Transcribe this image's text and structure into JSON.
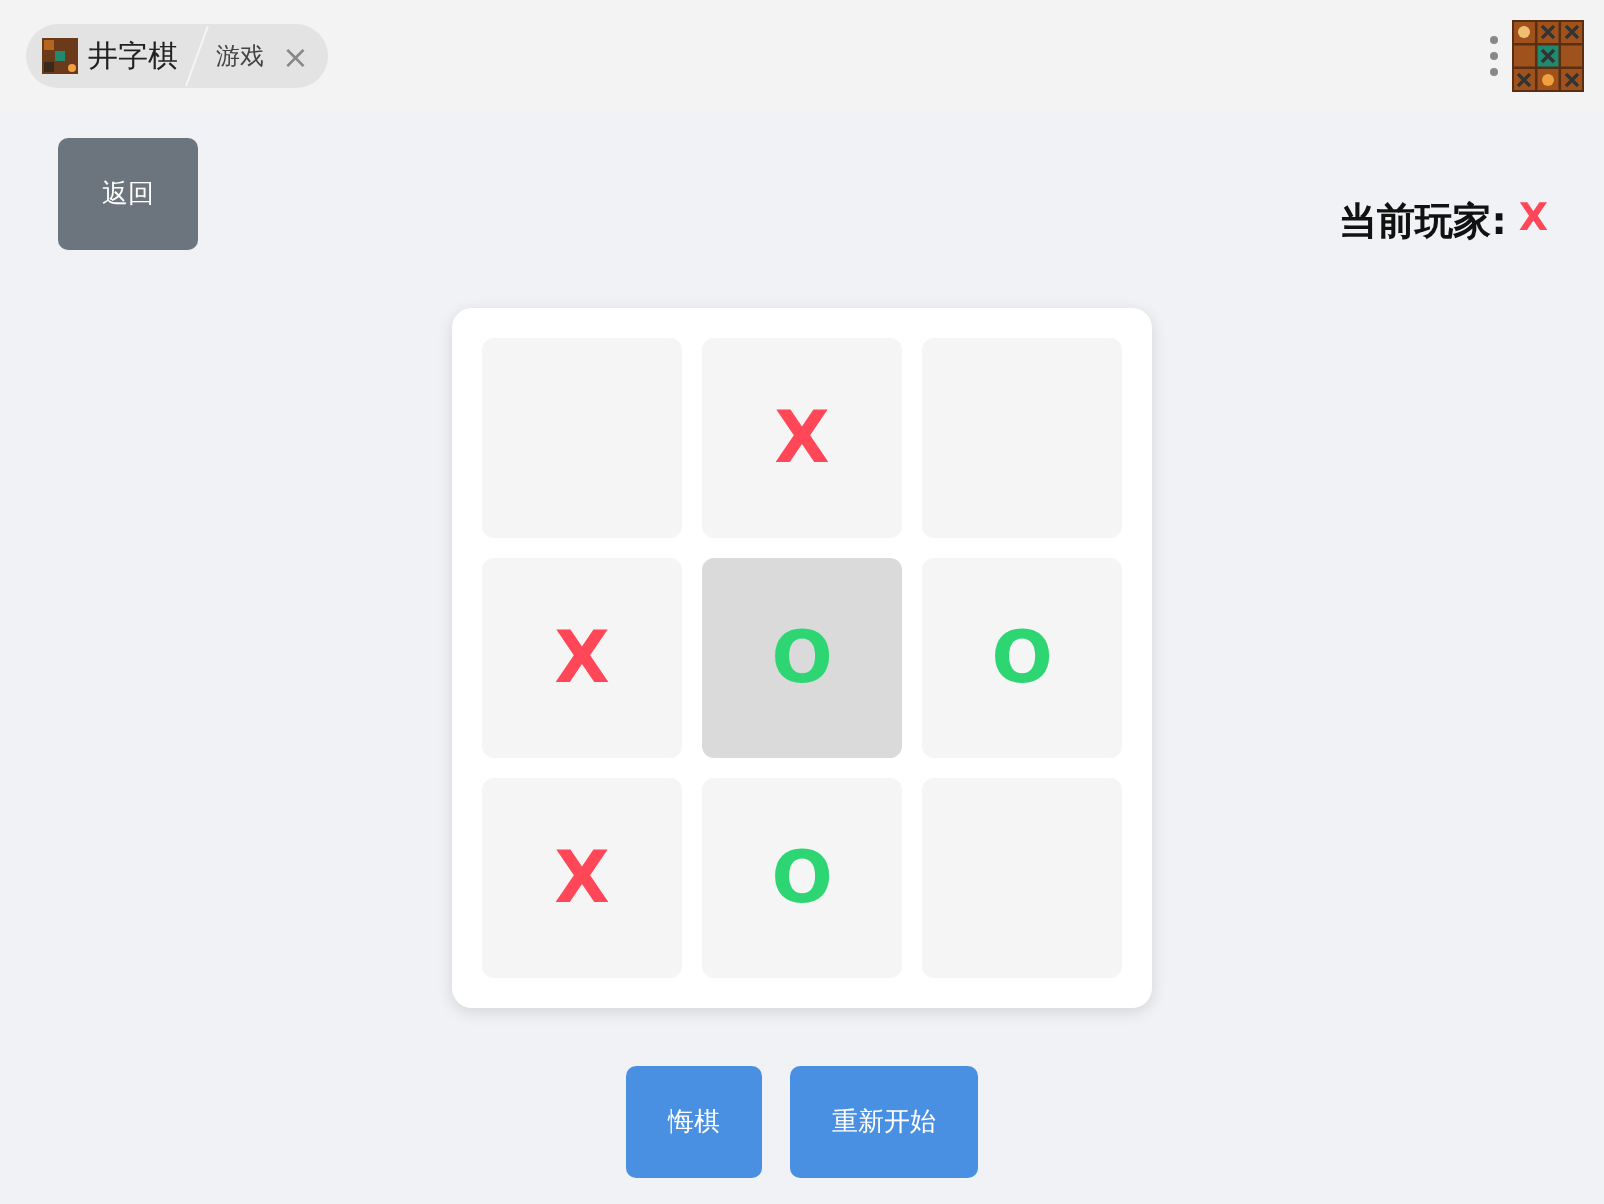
{
  "tab": {
    "title": "井字棋",
    "subtitle": "游戏",
    "close": "×"
  },
  "back_button": "返回",
  "current_player": {
    "label": "当前玩家:",
    "player": "X"
  },
  "board": [
    {
      "highlighted": false
    },
    {
      "mark": "X",
      "highlighted": false
    },
    {
      "highlighted": false
    },
    {
      "mark": "X",
      "highlighted": false
    },
    {
      "mark": "O",
      "highlighted": true
    },
    {
      "mark": "O",
      "highlighted": false
    },
    {
      "mark": "X",
      "highlighted": false
    },
    {
      "mark": "O",
      "highlighted": false
    },
    {
      "highlighted": false
    }
  ],
  "buttons": [
    "悔棋",
    "重新开始"
  ]
}
